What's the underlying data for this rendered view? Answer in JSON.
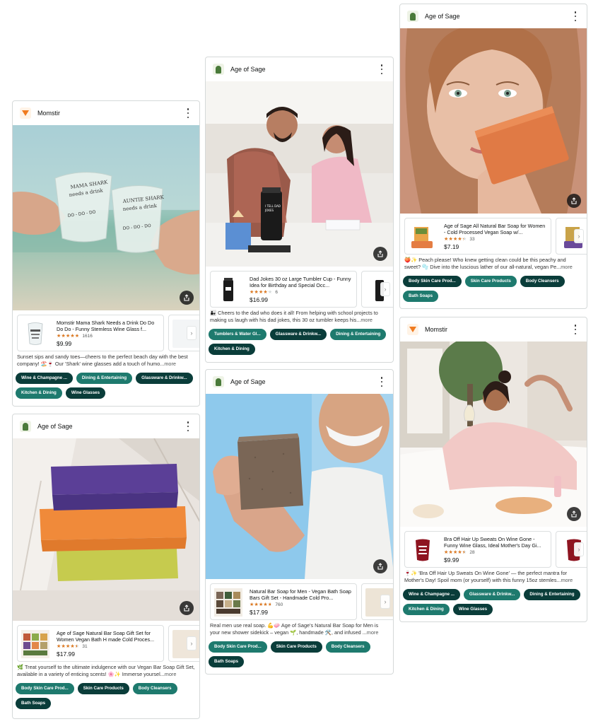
{
  "cards": [
    {
      "brand": "Momstir",
      "logo": "momstir-logo",
      "product": {
        "title": "Momstir Mama Shark Needs a Drink Do Do Do Do - Funny Stemless Wine Glass f...",
        "rating": 4.8,
        "reviews": "1616",
        "price": "$9.99"
      },
      "caption": "Sunset sips and sandy toes—cheers to the perfect beach day with the best company! 🏖️🍷 Our 'Shark' wine glasses add a touch of humo...",
      "more": "more",
      "tags": [
        {
          "label": "Wine & Champagne ...",
          "color": "#0a3d3a"
        },
        {
          "label": "Dining & Entertaining",
          "color": "#1e7a6e"
        },
        {
          "label": "Glassware & Drinkw...",
          "color": "#0a3d3a"
        },
        {
          "label": "Kitchen & Dining",
          "color": "#1e7a6e"
        },
        {
          "label": "Wine Glasses",
          "color": "#0a3d3a"
        }
      ]
    },
    {
      "brand": "Age of Sage",
      "logo": "age-of-sage-logo",
      "product": {
        "title": "Age of Sage Natural Bar Soap Gift Set for Women Vegan Bath H made Cold Proces...",
        "rating": 4.5,
        "reviews": "31",
        "price": "$17.99"
      },
      "caption": "🌿 Treat yourself to the ultimate indulgence with our Vegan Bar Soap Gift Set, available in a variety of enticing scents! 🌸✨ Immerse yoursel...",
      "more": "more",
      "tags": [
        {
          "label": "Body Skin Care Prod...",
          "color": "#1e7a6e"
        },
        {
          "label": "Skin Care Products",
          "color": "#0a3d3a"
        },
        {
          "label": "Body Cleansers",
          "color": "#1e7a6e"
        },
        {
          "label": "Bath Soaps",
          "color": "#0a3d3a"
        }
      ]
    },
    {
      "brand": "Age of Sage",
      "logo": "age-of-sage-logo",
      "product": {
        "title": "Dad Jokes 30 oz Large Tumbler Cup - Funny Idea for Birthday and Special Occ...",
        "rating": 4.2,
        "reviews": "6",
        "price": "$16.99"
      },
      "caption": "👨‍👧 Cheers to the dad who does it all! From helping with school projects to making us laugh with his dad jokes, this 30 oz tumbler keeps his...",
      "more": "more",
      "tags": [
        {
          "label": "Tumblers & Water Gl...",
          "color": "#1e7a6e"
        },
        {
          "label": "Glassware & Drinkw...",
          "color": "#0a3d3a"
        },
        {
          "label": "Dining & Entertaining",
          "color": "#1e7a6e"
        },
        {
          "label": "Kitchen & Dining",
          "color": "#0a3d3a"
        }
      ]
    },
    {
      "brand": "Age of Sage",
      "logo": "age-of-sage-logo",
      "product": {
        "title": "Natural Bar Soap for Men - Vegan Bath Soap Bars Gift Set - Handmade Cold Pro...",
        "rating": 4.6,
        "reviews": "760",
        "price": "$17.99"
      },
      "caption": "Real men use real soap. 💪🧼 Age of Sage's Natural Bar Soap for Men is your new shower sidekick – vegan 🌱, handmade 🛠️, and infused ...",
      "more": "more",
      "tags": [
        {
          "label": "Body Skin Care Prod...",
          "color": "#1e7a6e"
        },
        {
          "label": "Skin Care Products",
          "color": "#0a3d3a"
        },
        {
          "label": "Body Cleansers",
          "color": "#1e7a6e"
        },
        {
          "label": "Bath Soaps",
          "color": "#0a3d3a"
        }
      ]
    },
    {
      "brand": "Age of Sage",
      "logo": "age-of-sage-logo",
      "product": {
        "title": "Age of Sage All Natural Bar Soap for Women - Cold Processed Vegan Soap w/...",
        "rating": 4.3,
        "reviews": "33",
        "price": "$7.19"
      },
      "caption": "🍑✨ Peach please! Who knew getting clean could be this peachy and sweet? 🫧 Dive into the luscious lather of our all-natural, vegan Pe...",
      "more": "more",
      "tags": [
        {
          "label": "Body Skin Care Prod...",
          "color": "#0a3d3a"
        },
        {
          "label": "Skin Care Products",
          "color": "#1e7a6e"
        },
        {
          "label": "Body Cleansers",
          "color": "#0a3d3a"
        },
        {
          "label": "Bath Soaps",
          "color": "#1e7a6e"
        }
      ]
    },
    {
      "brand": "Momstir",
      "logo": "momstir-logo",
      "product": {
        "title": "Bra Off Hair Up Sweats On Wine Gone - Funny Wine Glass, Ideal Mother's Day Gi...",
        "rating": 4.5,
        "reviews": "28",
        "price": "$9.99"
      },
      "caption": "🍷✨ 'Bra Off Hair Up Sweats On Wine Gone' — the perfect mantra for Mother's Day! Spoil mom (or yourself) with this funny 15oz stemles...",
      "more": "more",
      "tags": [
        {
          "label": "Wine & Champagne ...",
          "color": "#0a3d3a"
        },
        {
          "label": "Glassware & Drinkw...",
          "color": "#1e7a6e"
        },
        {
          "label": "Dining & Entertaining",
          "color": "#0a3d3a"
        },
        {
          "label": "Kitchen & Dining",
          "color": "#1e7a6e"
        },
        {
          "label": "Wine Glasses",
          "color": "#0a3d3a"
        }
      ]
    }
  ],
  "icons": {
    "share": "share-icon",
    "menu": "more-options-icon",
    "next": "chevron-right-icon"
  }
}
